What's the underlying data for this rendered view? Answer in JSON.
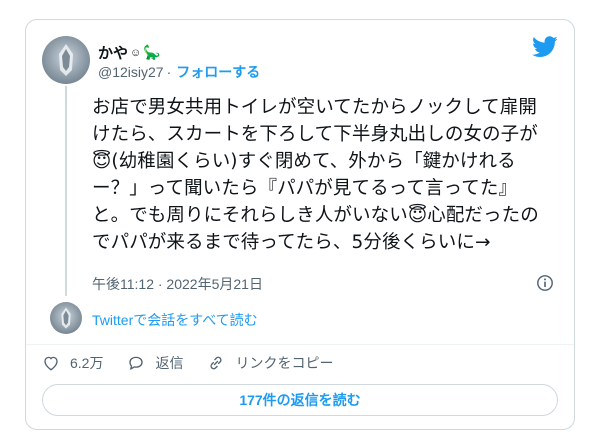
{
  "user": {
    "display_name": "かや",
    "name_emoji": "☺",
    "name_emoji2": "🦕",
    "handle": "@12isiy27",
    "separator": "·",
    "follow_label": "フォローする"
  },
  "tweet": {
    "text": "お店で男女共用トイレが空いてたからノックして扉開けたら、スカートを下ろして下半身丸出しの女の子が😇(幼稚園くらい)すぐ閉めて、外から「鍵かけれるー？」って聞いたら『パパが見てるって言ってた』と。でも周りにそれらしき人がいない😇心配だったのでパパが来るまで待ってたら、5分後くらいに→",
    "timestamp": "午後11:12 · 2022年5月21日"
  },
  "conversation": {
    "label": "Twitterで会話をすべて読む"
  },
  "actions": {
    "like_count": "6.2万",
    "reply_label": "返信",
    "copy_link_label": "リンクをコピー"
  },
  "replies_button": {
    "label": "177件の返信を読む"
  },
  "colors": {
    "accent": "#1d9bf0",
    "muted": "#536471",
    "border": "#cfd9de"
  },
  "icons": [
    "twitter-bird-icon",
    "info-icon",
    "heart-icon",
    "reply-icon",
    "link-icon"
  ]
}
